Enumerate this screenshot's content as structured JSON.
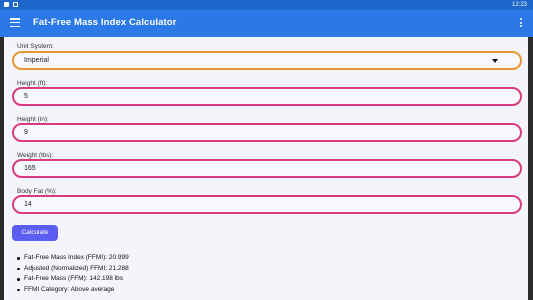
{
  "status_bar": {
    "time": "12:23"
  },
  "app_bar": {
    "title": "Fat-Free Mass Index Calculator"
  },
  "form": {
    "unit_system": {
      "label": "Unit System:",
      "value": "Imperial"
    },
    "height_ft": {
      "label": "Height (ft):",
      "value": "5"
    },
    "height_in": {
      "label": "Height (in):",
      "value": "9"
    },
    "weight": {
      "label": "Weight (lbs):",
      "value": "165"
    },
    "body_fat": {
      "label": "Body Fat (%):",
      "value": "14"
    }
  },
  "calculate_button": {
    "label": "Calculate"
  },
  "results": [
    "Fat-Free Mass Index (FFMI): 20.999",
    "Adjusted (Normalized) FFMI: 21.288",
    "Fat-Free Mass (FFM): 142.198 lbs",
    "FFMI Category: Above average"
  ],
  "colors": {
    "app_bar": "#2a79e6",
    "status_bar": "#1e66c9",
    "field_border": "#d93a7f",
    "select_border": "#e79735",
    "button": "#5b5cf0",
    "background": "#f3f5fa"
  }
}
